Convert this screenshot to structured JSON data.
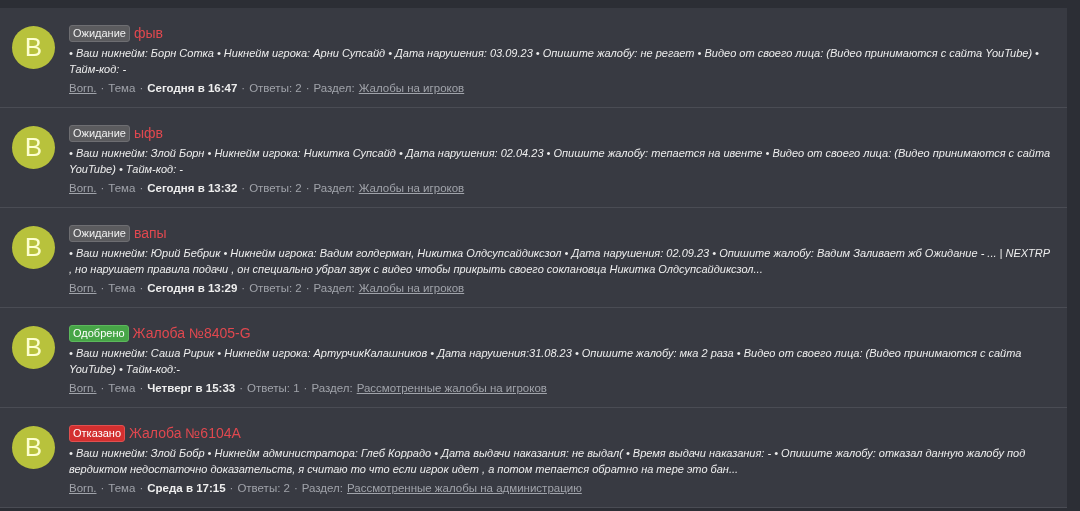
{
  "separator": "·",
  "threads": [
    {
      "avatar": "B",
      "status": {
        "label": "Ожидание",
        "kind": "waiting"
      },
      "title": "фыв",
      "body": "• Ваш никнейм: Борн Сотка • Никнейм игрока: Арни Супсайд • Дата нарушения: 03.09.23 • Опишите жалобу: не регает • Видео от своего лица: (Видео принимаются с сайта YouTube) • Тайм-код: -",
      "meta": {
        "author": "Born.",
        "type": "Тема",
        "date": "Сегодня в 16:47",
        "replies": "Ответы: 2",
        "section_label": "Раздел:",
        "section": "Жалобы на игроков"
      }
    },
    {
      "avatar": "B",
      "status": {
        "label": "Ожидание",
        "kind": "waiting"
      },
      "title": "ыфв",
      "body": "• Ваш никнейм: Злой Борн • Никнейм игрока: Никитка Супсайд • Дата нарушения: 02.04.23 • Опишите жалобу: тепается на ивенте • Видео от своего лица: (Видео принимаются с сайта YouTube) • Тайм-код: -",
      "meta": {
        "author": "Born.",
        "type": "Тема",
        "date": "Сегодня в 13:32",
        "replies": "Ответы: 2",
        "section_label": "Раздел:",
        "section": "Жалобы на игроков"
      }
    },
    {
      "avatar": "B",
      "status": {
        "label": "Ожидание",
        "kind": "waiting"
      },
      "title": "вапы",
      "body": "• Ваш никнейм: Юрий Бебрик • Никнейм игрока: Вадим голдерман, Никитка Олдсупсайдиксзол • Дата нарушения: 02.09.23 • Опишите жалобу: Вадим Заливает жб Ожидание - ... | NEXTRP , но нарушает правила подачи , он специально убрал звук с видео чтобы прикрыть своего соклановца Никитка Олдсупсайдиксзол...",
      "meta": {
        "author": "Born.",
        "type": "Тема",
        "date": "Сегодня в 13:29",
        "replies": "Ответы: 2",
        "section_label": "Раздел:",
        "section": "Жалобы на игроков"
      }
    },
    {
      "avatar": "B",
      "status": {
        "label": "Одобрено",
        "kind": "approved"
      },
      "title": "Жалоба №8405-G",
      "body": "• Ваш никнейм: Саша Ририк • Никнейм игрока: АртурчикКалашников • Дата нарушения:31.08.23 • Опишите жалобу: мка 2 раза • Видео от своего лица: (Видео принимаются с сайта YouTube) • Тайм-код:-",
      "meta": {
        "author": "Born.",
        "type": "Тема",
        "date": "Четверг в 15:33",
        "replies": "Ответы: 1",
        "section_label": "Раздел:",
        "section": "Рассмотренные жалобы на игроков"
      }
    },
    {
      "avatar": "B",
      "status": {
        "label": "Отказано",
        "kind": "rejected"
      },
      "title": "Жалоба №6104A",
      "body": "• Ваш никнейм: Злой Бобр • Никнейм администратора: Глеб Коррадо • Дата выдачи наказания: не выдал( • Время выдачи наказания: - • Опишите жалобу: отказал данную жалобу под вердиктом недостаточно доказательств, я считаю то что если игрок идет , а потом тепается обратно на тере это бан...",
      "meta": {
        "author": "Born.",
        "type": "Тема",
        "date": "Среда в 17:15",
        "replies": "Ответы: 2",
        "section_label": "Раздел:",
        "section": "Рассмотренные жалобы на администрацию"
      }
    }
  ]
}
